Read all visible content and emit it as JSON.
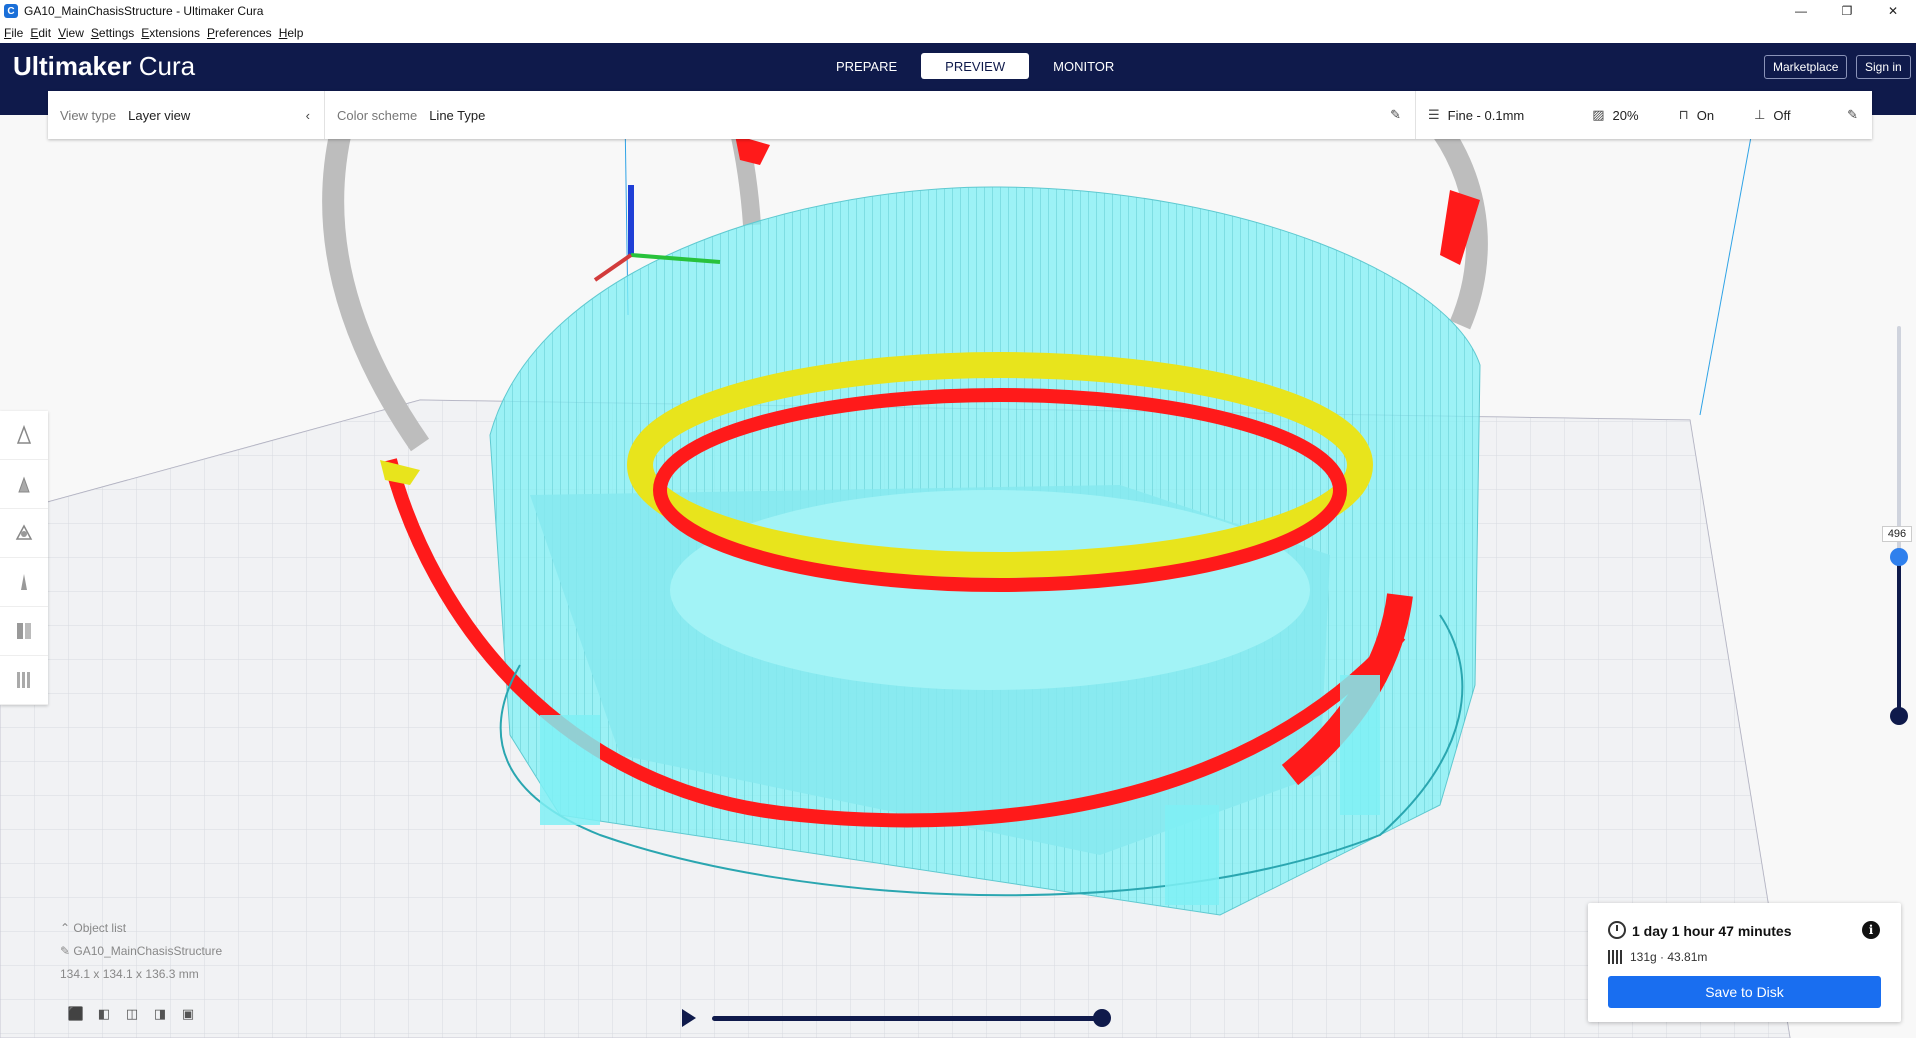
{
  "window": {
    "title": "GA10_MainChasisStructure - Ultimaker Cura",
    "controls": [
      "—",
      "❐",
      "✕"
    ]
  },
  "menu": [
    "File",
    "Edit",
    "View",
    "Settings",
    "Extensions",
    "Preferences",
    "Help"
  ],
  "header": {
    "brand_bold": "Ultimaker",
    "brand_light": "Cura",
    "stages": [
      "PREPARE",
      "PREVIEW",
      "MONITOR"
    ],
    "active_stage": "PREVIEW",
    "marketplace": "Marketplace",
    "sign_in": "Sign in"
  },
  "settings_bar": {
    "view_type_label": "View type",
    "view_type_value": "Layer view",
    "color_scheme_label": "Color scheme",
    "color_scheme_value": "Line Type",
    "profile": "Fine - 0.1mm",
    "infill": "20%",
    "support": "On",
    "adhesion": "Off"
  },
  "tools": [
    "move-tool-icon",
    "scale-tool-icon",
    "rotate-tool-icon",
    "mirror-tool-icon",
    "per-model-settings-icon",
    "support-blocker-icon"
  ],
  "layer_slider": {
    "current_layer": "496",
    "position_fraction": 0.82
  },
  "object_list": {
    "header": "Object list",
    "object_name": "GA10_MainChasisStructure",
    "dimensions": "134.1 x 134.1 x 136.3 mm"
  },
  "simulation": {
    "progress": 1.0
  },
  "estimate": {
    "time": "1 day 1 hour 47 minutes",
    "material": "131g · 43.81m",
    "save_label": "Save to Disk"
  },
  "colors": {
    "header_bg": "#0f1a4b",
    "accent_blue": "#196ef0",
    "wall_red": "#ff1a1a",
    "infill_yellow": "#e8e41c",
    "support_cyan": "#7ff0f5"
  }
}
